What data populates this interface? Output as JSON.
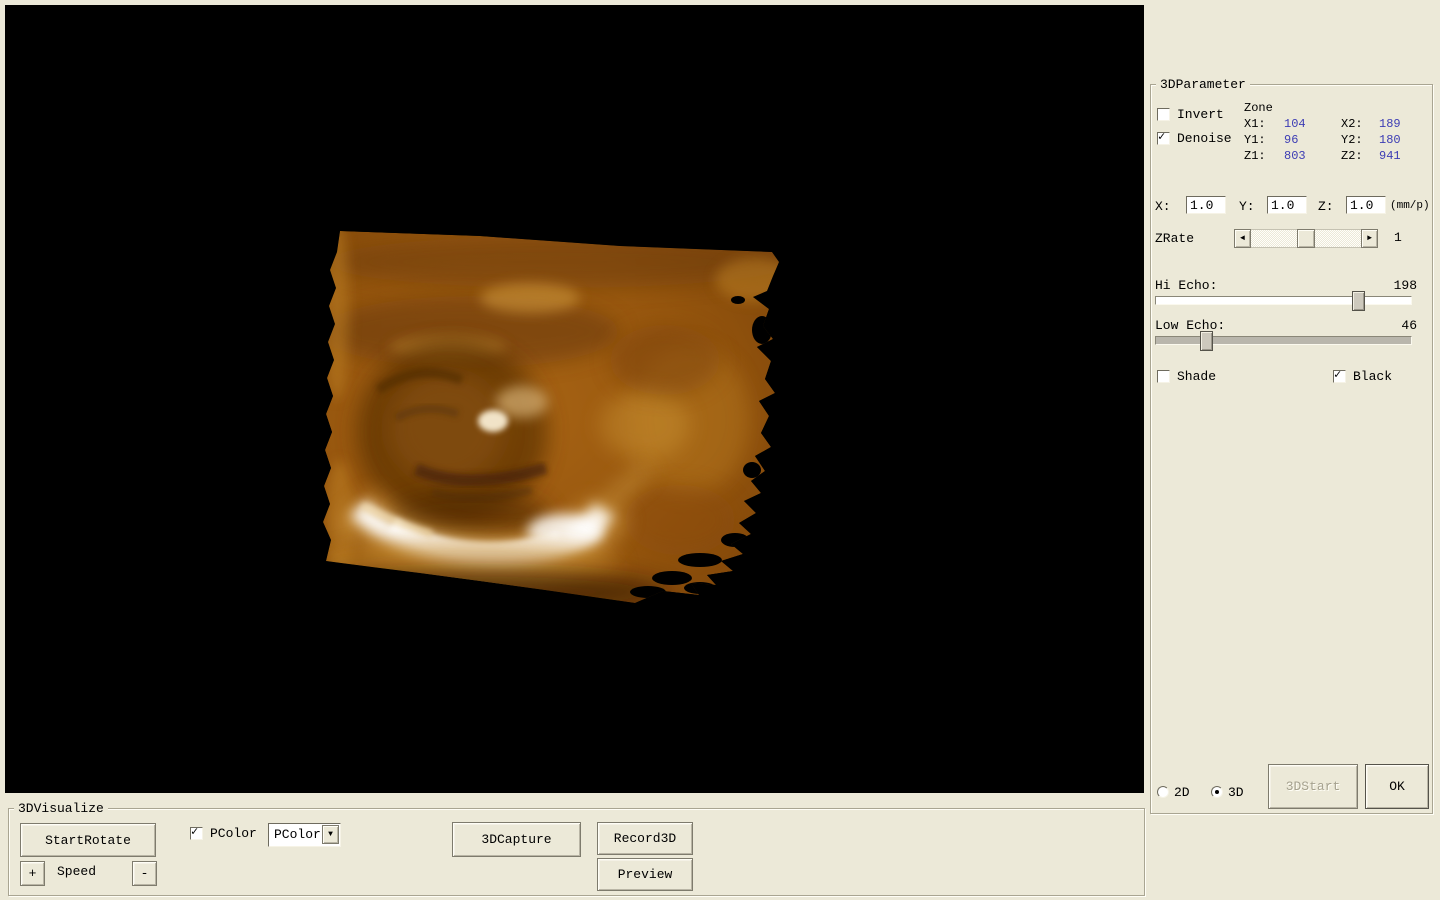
{
  "colors": {
    "panel_bg": "#ece9d8",
    "viewport_bg": "#000000",
    "zone_value_blue": "#3c3cb4",
    "render_amber": "#96560e"
  },
  "icons": {
    "check": "✓",
    "arrow_left": "◄",
    "arrow_right": "►",
    "arrow_down": "▼"
  },
  "parameter_panel": {
    "title": "3DParameter",
    "invert_label": "Invert",
    "denoise_label": "Denoise",
    "zone": {
      "title": "Zone",
      "x1_label": "X1:",
      "x1_value": "104",
      "x2_label": "X2:",
      "x2_value": "189",
      "y1_label": "Y1:",
      "y1_value": "96",
      "y2_label": "Y2:",
      "y2_value": "180",
      "z1_label": "Z1:",
      "z1_value": "803",
      "z2_label": "Z2:",
      "z2_value": "941"
    },
    "scale": {
      "x_label": "X:",
      "x_value": "1.0",
      "y_label": "Y:",
      "y_value": "1.0",
      "z_label": "Z:",
      "z_value": "1.0",
      "unit": "(mm/p)"
    },
    "zrate": {
      "label": "ZRate",
      "value": "1"
    },
    "hi_echo": {
      "label": "Hi Echo:",
      "value": "198"
    },
    "low_echo": {
      "label": "Low Echo:",
      "value": "46"
    },
    "shade_label": "Shade",
    "black_label": "Black",
    "mode_2d_label": "2D",
    "mode_3d_label": "3D",
    "start_button": "3DStart",
    "ok_button": "OK"
  },
  "visualize_panel": {
    "title": "3DVisualize",
    "start_rotate_button": "StartRotate",
    "speed_plus": "+",
    "speed_label": "Speed",
    "speed_minus": "-",
    "pcolor_label": "PColor",
    "pcolor_selected": "PColor",
    "capture_button": "3DCapture",
    "record_button": "Record3D",
    "preview_button": "Preview"
  }
}
